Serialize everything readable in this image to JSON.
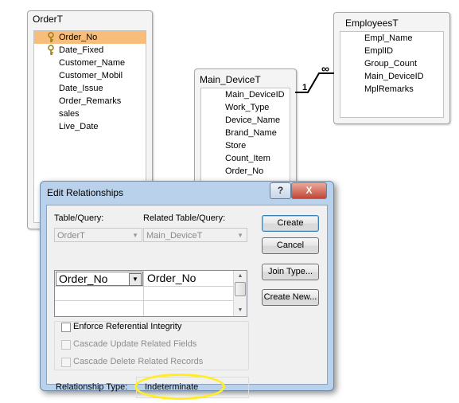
{
  "tables": {
    "order": {
      "title": "OrderT",
      "fields": [
        {
          "name": "Order_No",
          "key": true,
          "selected": true
        },
        {
          "name": "Date_Fixed",
          "key": true,
          "selected": false
        },
        {
          "name": "Customer_Name",
          "key": false,
          "selected": false
        },
        {
          "name": "Customer_Mobil",
          "key": false,
          "selected": false
        },
        {
          "name": "Date_Issue",
          "key": false,
          "selected": false
        },
        {
          "name": "Order_Remarks",
          "key": false,
          "selected": false
        },
        {
          "name": "sales",
          "key": false,
          "selected": false
        },
        {
          "name": "Live_Date",
          "key": false,
          "selected": false
        }
      ]
    },
    "main_device": {
      "title": "Main_DeviceT",
      "fields": [
        {
          "name": "Main_DeviceID"
        },
        {
          "name": "Work_Type"
        },
        {
          "name": "Device_Name"
        },
        {
          "name": "Brand_Name"
        },
        {
          "name": "Store"
        },
        {
          "name": "Count_Item"
        },
        {
          "name": "Order_No"
        }
      ]
    },
    "employees": {
      "title": "EmployeesT",
      "fields": [
        {
          "name": "Empl_Name"
        },
        {
          "name": "EmplID"
        },
        {
          "name": "Group_Count"
        },
        {
          "name": "Main_DeviceID"
        },
        {
          "name": "MplRemarks"
        }
      ]
    }
  },
  "relationship_line": {
    "one_label": "1",
    "many_label": "∞"
  },
  "dialog": {
    "title": "Edit Relationships",
    "help_label": "?",
    "close_label": "X",
    "table_query_label": "Table/Query:",
    "related_table_query_label": "Related Table/Query:",
    "table_value": "OrderT",
    "related_table_value": "Main_DeviceT",
    "grid": {
      "left_field": "Order_No",
      "right_field": "Order_No"
    },
    "enforce_label": "Enforce Referential Integrity",
    "cascade_update_label": "Cascade Update Related Fields",
    "cascade_delete_label": "Cascade Delete Related Records",
    "relationship_type_label": "Relationship Type:",
    "relationship_type_value": "Indeterminate",
    "buttons": {
      "create": "Create",
      "cancel": "Cancel",
      "join_type": "Join Type...",
      "create_new": "Create New..."
    }
  },
  "colors": {
    "selected_row": "#f6bd7b",
    "highlight_ellipse": "#ffee22",
    "dialog_frame": "#b9d1ea"
  }
}
